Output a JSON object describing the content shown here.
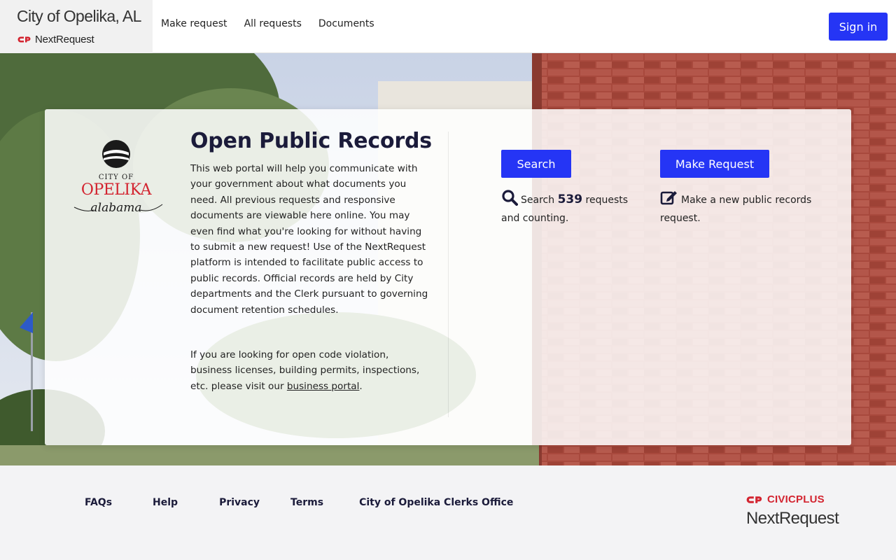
{
  "header": {
    "city_name": "City of Opelika, AL",
    "brand_product": "NextRequest",
    "nav": [
      {
        "label": "Make request"
      },
      {
        "label": "All requests"
      },
      {
        "label": "Documents"
      }
    ],
    "sign_in": "Sign in"
  },
  "hero": {
    "logo": {
      "city_of": "CITY OF",
      "name": "OPELIKA",
      "state": "alabama"
    },
    "title": "Open Public Records",
    "description": "This web portal will help you communicate with your government about what documents you need. All previous requests and responsive documents are viewable here online. You may even find what you're looking for without having to submit a new request! Use of the NextRequest platform is intended to facilitate public access to public records. Official records are held by City departments and the Clerk pursuant to governing document retention schedules.",
    "notice_prefix": "If you are looking for open code violation, business licenses, building permits, inspections, etc. please visit our ",
    "notice_link": "business portal",
    "notice_suffix": ".",
    "search": {
      "button": "Search",
      "text_before": "Search",
      "count": "539",
      "text_after": "requests and counting."
    },
    "make_request": {
      "button": "Make Request",
      "text": "Make a new public records request."
    }
  },
  "footer": {
    "links": [
      {
        "label": "FAQs"
      },
      {
        "label": "Help"
      },
      {
        "label": "Privacy"
      },
      {
        "label": "Terms"
      },
      {
        "label": "City of Opelika Clerks Office"
      }
    ],
    "vendor": "CIVICPLUS",
    "vendor_product": "NextRequest"
  },
  "colors": {
    "primary_button": "#2535f5",
    "title_navy": "#1b1b3a",
    "civicplus_red": "#d32430"
  }
}
